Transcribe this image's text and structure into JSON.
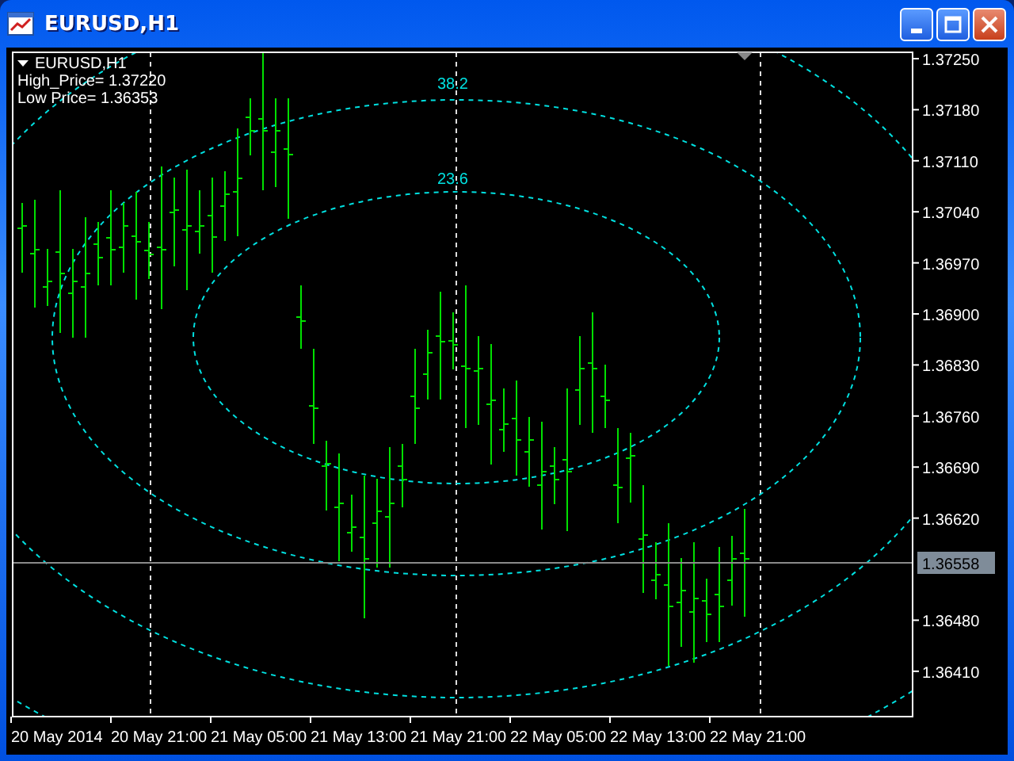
{
  "window": {
    "title": "EURUSD,H1"
  },
  "chart": {
    "symbol": "EURUSD,H1",
    "info_lines": [
      "High_Price= 1.37220",
      "Low Price= 1.36353"
    ],
    "fibo_labels": [
      "38.2",
      "23.6"
    ],
    "price_labels": [
      "1.37250",
      "1.37180",
      "1.37110",
      "1.37040",
      "1.36970",
      "1.36900",
      "1.36830",
      "1.36760",
      "1.36690",
      "1.36620",
      "1.36480",
      "1.36410"
    ],
    "current_price": "1.36558",
    "time_labels": [
      "20 May 2014",
      "20 May 21:00",
      "21 May 05:00",
      "21 May 13:00",
      "21 May 21:00",
      "22 May 05:00",
      "22 May 13:00",
      "22 May 21:00"
    ]
  }
}
